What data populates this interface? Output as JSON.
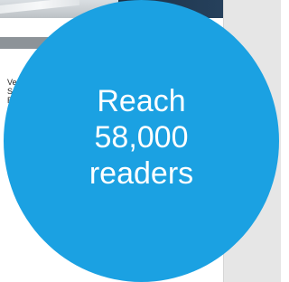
{
  "article": {
    "lines": [
      "Ve",
      "S",
      "R"
    ]
  },
  "promo": {
    "line1": "Reach",
    "line2": "58,000",
    "line3": "readers",
    "color": "#1ba1e2"
  }
}
